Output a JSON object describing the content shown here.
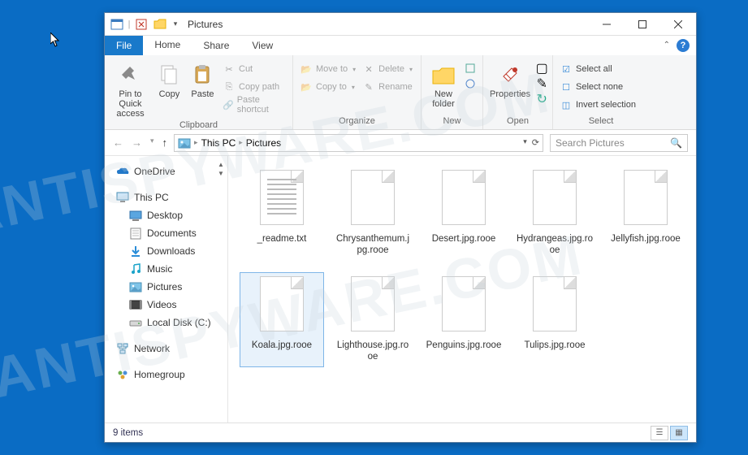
{
  "titlebar": {
    "title": "Pictures"
  },
  "tabs": {
    "file": "File",
    "home": "Home",
    "share": "Share",
    "view": "View"
  },
  "ribbon": {
    "clipboard": {
      "label": "Clipboard",
      "pin": "Pin to Quick access",
      "copy": "Copy",
      "paste": "Paste",
      "cut": "Cut",
      "copy_path": "Copy path",
      "paste_shortcut": "Paste shortcut"
    },
    "organize": {
      "label": "Organize",
      "move_to": "Move to",
      "copy_to": "Copy to",
      "delete": "Delete",
      "rename": "Rename"
    },
    "new": {
      "label": "New",
      "new_folder": "New folder"
    },
    "open": {
      "label": "Open",
      "properties": "Properties"
    },
    "select": {
      "label": "Select",
      "select_all": "Select all",
      "select_none": "Select none",
      "invert": "Invert selection"
    }
  },
  "address": {
    "root": "This PC",
    "folder": "Pictures"
  },
  "search": {
    "placeholder": "Search Pictures"
  },
  "sidebar": {
    "onedrive": "OneDrive",
    "thispc": "This PC",
    "desktop": "Desktop",
    "documents": "Documents",
    "downloads": "Downloads",
    "music": "Music",
    "pictures": "Pictures",
    "videos": "Videos",
    "localdisk": "Local Disk (C:)",
    "network": "Network",
    "homegroup": "Homegroup"
  },
  "files": [
    {
      "name": "_readme.txt",
      "type": "txt"
    },
    {
      "name": "Chrysanthemum.jpg.rooe",
      "type": "blank"
    },
    {
      "name": "Desert.jpg.rooe",
      "type": "blank"
    },
    {
      "name": "Hydrangeas.jpg.rooe",
      "type": "blank"
    },
    {
      "name": "Jellyfish.jpg.rooe",
      "type": "blank"
    },
    {
      "name": "Koala.jpg.rooe",
      "type": "blank",
      "selected": true
    },
    {
      "name": "Lighthouse.jpg.rooe",
      "type": "blank"
    },
    {
      "name": "Penguins.jpg.rooe",
      "type": "blank"
    },
    {
      "name": "Tulips.jpg.rooe",
      "type": "blank"
    }
  ],
  "status": {
    "count": "9 items"
  },
  "watermark": "MYANTISPYWARE.COM"
}
